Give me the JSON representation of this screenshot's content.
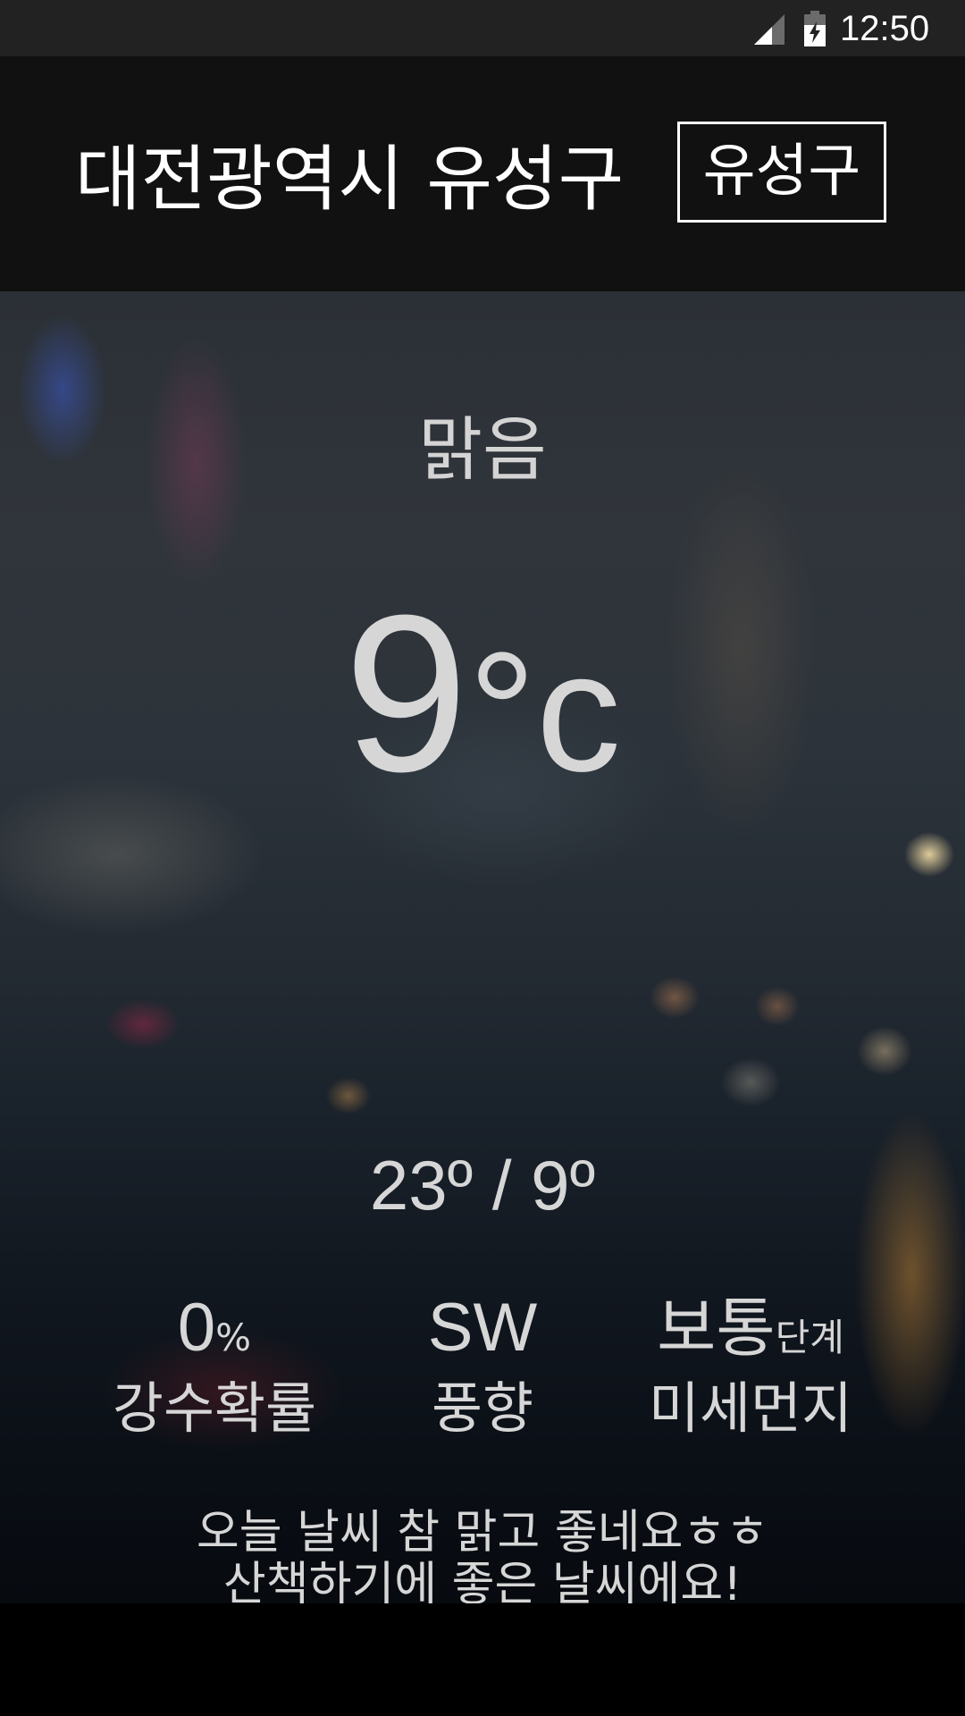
{
  "status_bar": {
    "time": "12:50",
    "icons": [
      "signal-icon",
      "battery-charging-icon"
    ]
  },
  "header": {
    "title": "대전광역시 유성구",
    "district_button": "유성구"
  },
  "weather": {
    "condition": "맑음",
    "temperature": "9",
    "temperature_unit": "°c",
    "high_low": "23º / 9º",
    "stats": {
      "precipitation": {
        "value": "0",
        "unit": "%",
        "label": "강수확률"
      },
      "wind": {
        "value": "SW",
        "label": "풍향"
      },
      "fine_dust": {
        "value": "보통",
        "unit": "단계",
        "label": "미세먼지"
      }
    },
    "message": {
      "line1": "오늘 날씨 참 맑고 좋네요ㅎㅎ",
      "line2": "산책하기에 좋은 날씨에요!"
    }
  },
  "colors": {
    "status_bar": "#222222",
    "header_bg": "#111111",
    "text_primary": "#ffffff",
    "text_weather": "#d6d6d6"
  }
}
